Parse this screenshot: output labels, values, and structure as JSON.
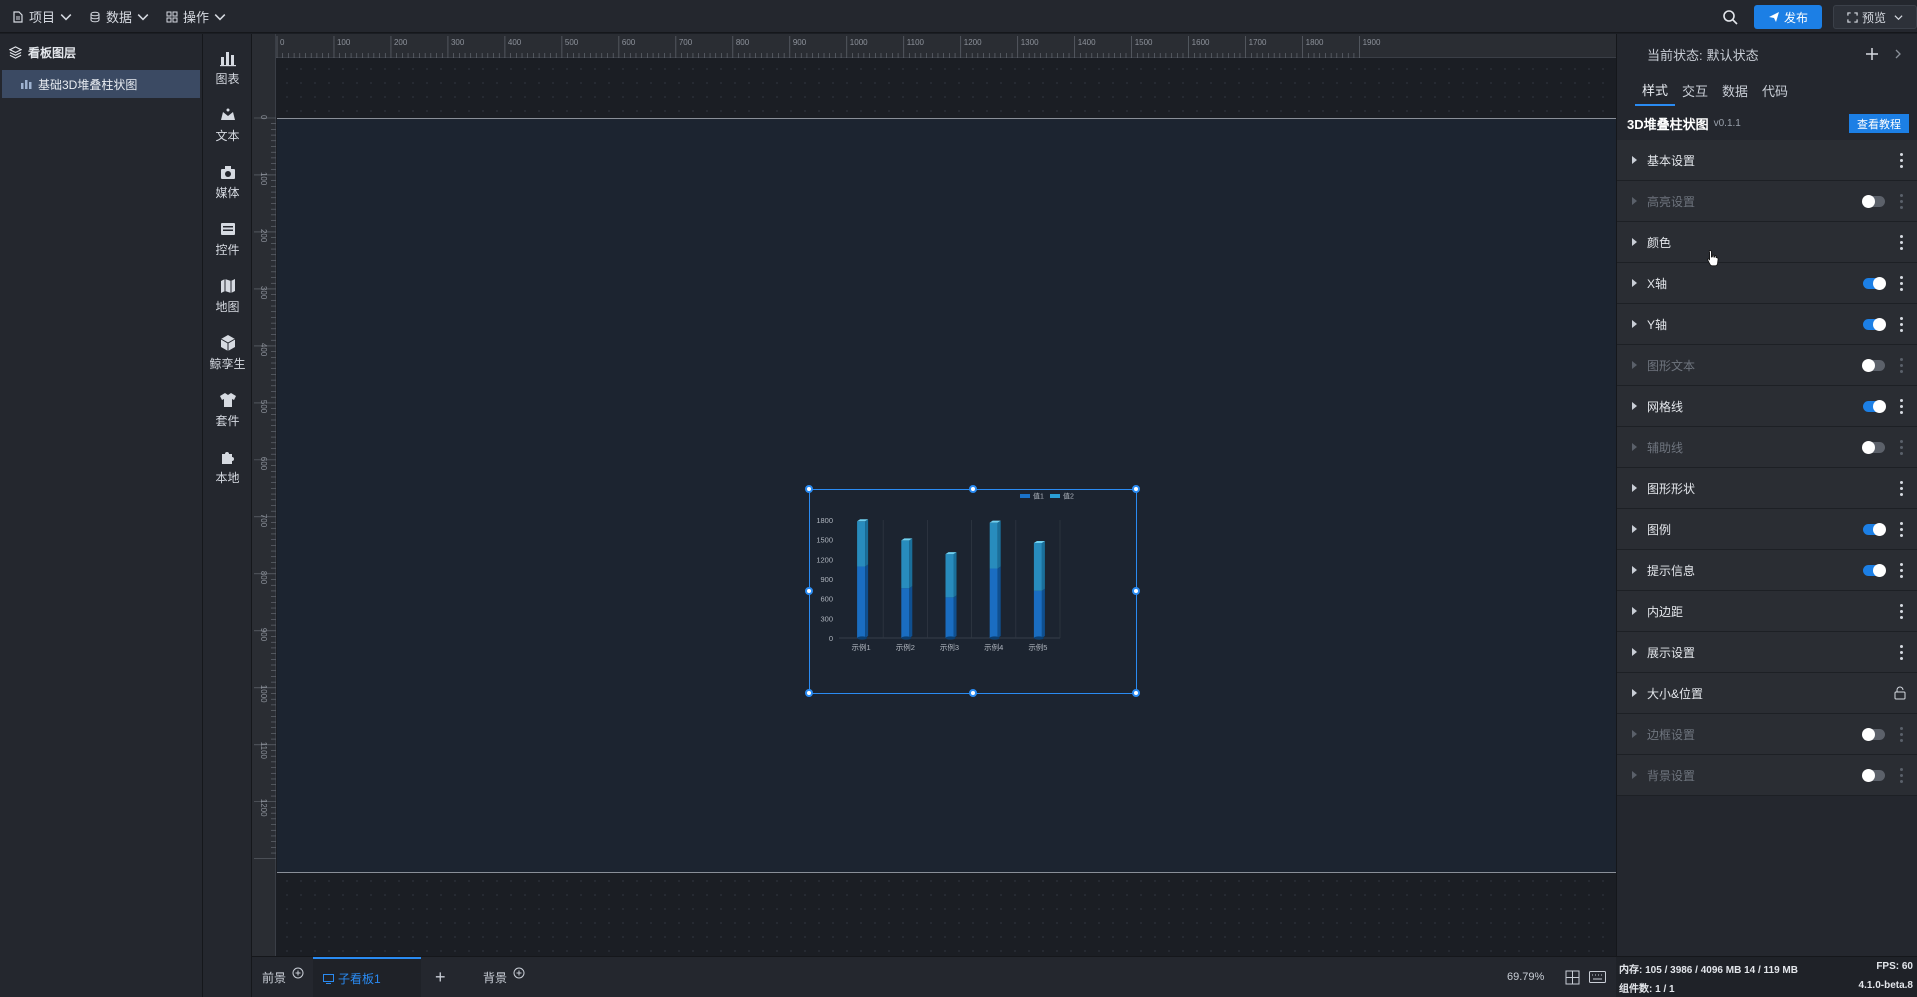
{
  "topbar": {
    "menus": [
      {
        "label": "项目",
        "icon": "file-icon"
      },
      {
        "label": "数据",
        "icon": "database-icon"
      },
      {
        "label": "操作",
        "icon": "grid-icon"
      }
    ],
    "publish_label": "发布",
    "preview_label": "预览"
  },
  "layers": {
    "title": "看板图层",
    "items": [
      {
        "label": "基础3D堆叠柱状图"
      }
    ]
  },
  "toolbox": [
    {
      "label": "图表",
      "icon": "bar-chart-icon"
    },
    {
      "label": "文本",
      "icon": "text-icon"
    },
    {
      "label": "媒体",
      "icon": "media-icon"
    },
    {
      "label": "控件",
      "icon": "widget-icon"
    },
    {
      "label": "地图",
      "icon": "map-icon"
    },
    {
      "label": "鲸孪生",
      "icon": "cube-icon"
    },
    {
      "label": "套件",
      "icon": "shirt-icon"
    },
    {
      "label": "本地",
      "icon": "puzzle-icon"
    }
  ],
  "ruler": {
    "top_ticks": [
      "0",
      "100",
      "200",
      "300",
      "400",
      "500",
      "600",
      "700",
      "800",
      "900",
      "1000",
      "1100",
      "1200",
      "1300",
      "1400",
      "1500",
      "1600",
      "1700",
      "1800",
      "1900"
    ],
    "left_ticks": [
      "0",
      "100",
      "200",
      "300",
      "400",
      "500",
      "600",
      "700",
      "800",
      "900",
      "1000",
      "1100",
      "1200"
    ]
  },
  "chart_data": {
    "type": "bar",
    "stacked": true,
    "style": "3d",
    "categories": [
      "示例1",
      "示例2",
      "示例3",
      "示例4",
      "示例5"
    ],
    "series": [
      {
        "name": "值1",
        "values": [
          1090,
          760,
          620,
          1060,
          720
        ],
        "color": "#1a72c9"
      },
      {
        "name": "值2",
        "values": [
          690,
          730,
          660,
          700,
          730
        ],
        "color": "#2a9fd6"
      }
    ],
    "y_ticks": [
      "0",
      "300",
      "600",
      "900",
      "1200",
      "1500",
      "1800"
    ],
    "ylim": [
      0,
      1800
    ],
    "legend_position": "top-right",
    "grid": true
  },
  "bottom_tabs": {
    "front": "前景",
    "active": "子看板1",
    "add": "+",
    "back": "背景",
    "zoom": "69.79%"
  },
  "props": {
    "state_label": "当前状态:",
    "state_value": "默认状态",
    "tabs": [
      "样式",
      "交互",
      "数据",
      "代码"
    ],
    "component_name": "3D堆叠柱状图",
    "component_version": "v0.1.1",
    "tutorial_label": "查看教程",
    "sections": [
      {
        "label": "基本设置",
        "enabled": true,
        "toggle": null
      },
      {
        "label": "高亮设置",
        "enabled": false,
        "toggle": "off"
      },
      {
        "label": "颜色",
        "enabled": true,
        "toggle": null
      },
      {
        "label": "X轴",
        "enabled": true,
        "toggle": "on"
      },
      {
        "label": "Y轴",
        "enabled": true,
        "toggle": "on"
      },
      {
        "label": "图形文本",
        "enabled": false,
        "toggle": "off"
      },
      {
        "label": "网格线",
        "enabled": true,
        "toggle": "on"
      },
      {
        "label": "辅助线",
        "enabled": false,
        "toggle": "off"
      },
      {
        "label": "图形形状",
        "enabled": true,
        "toggle": null
      },
      {
        "label": "图例",
        "enabled": true,
        "toggle": "on"
      },
      {
        "label": "提示信息",
        "enabled": true,
        "toggle": "on"
      },
      {
        "label": "内边距",
        "enabled": true,
        "toggle": null
      },
      {
        "label": "展示设置",
        "enabled": true,
        "toggle": null
      },
      {
        "label": "大小&位置",
        "enabled": true,
        "toggle": "lock"
      },
      {
        "label": "边框设置",
        "enabled": false,
        "toggle": "off"
      },
      {
        "label": "背景设置",
        "enabled": false,
        "toggle": "off"
      }
    ]
  },
  "status": {
    "memory": "内存: 105 / 3986 / 4096 MB  14 / 119 MB",
    "fps": "FPS: 60",
    "components": "组件数: 1 / 1",
    "version": "4.1.0-beta.8"
  },
  "colors": {
    "accent": "#1c7fe5",
    "panel_bg": "#24272e",
    "canvas_bg": "#1c2430"
  }
}
